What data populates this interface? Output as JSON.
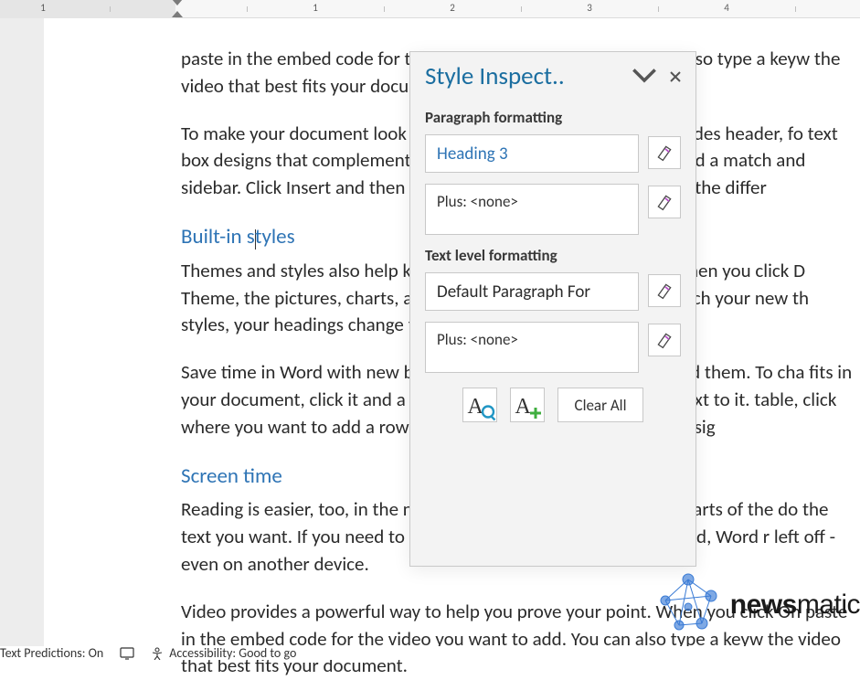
{
  "ruler": {
    "labels": [
      "1",
      "1",
      "2",
      "3",
      "4"
    ]
  },
  "document": {
    "p1": "paste in the embed code for the video you want to add. You can also type a keyw the video that best fits your document.",
    "p2": "To make your document look professionally produced, Word provides header, fo text box designs that complement each other. For example, you can add a match and sidebar. Click Insert and then choose the elements you want from the differ",
    "h1": "Built-in styles",
    "p3": "Themes and styles also help keep your document coordinated. When you click D Theme, the pictures, charts, and SmartArt graphics change to match your new th styles, your headings change to match the new theme.",
    "p4": "Save time in Word with new buttons that show up where you need them. To cha fits in your document, click it and a button for layout options appears next to it. table, click where you want to add a row or a column, and then click the plus sig",
    "h2": "Screen time",
    "p5": "Reading is easier, too, in the new Reading view. You can collapse parts of the do the text you want. If you need to stop reading before you reach the end, Word r left off - even on another device.",
    "p6": "Video provides a powerful way to help you prove your point. When you click On paste in the embed code for the video you want to add. You can also type a keyw the video that best fits your document."
  },
  "pane": {
    "title": "Style Inspect..",
    "paragraph_formatting_label": "Paragraph formatting",
    "paragraph_style": "Heading 3",
    "paragraph_plus": "Plus: <none>",
    "text_formatting_label": "Text level formatting",
    "text_style": "Default Paragraph For",
    "text_plus": "Plus: <none>",
    "clear_all": "Clear All"
  },
  "status": {
    "predictions": "Text Predictions: On",
    "accessibility": "Accessibility: Good to go"
  },
  "watermark": {
    "brand_a": "news",
    "brand_b": "matic"
  }
}
